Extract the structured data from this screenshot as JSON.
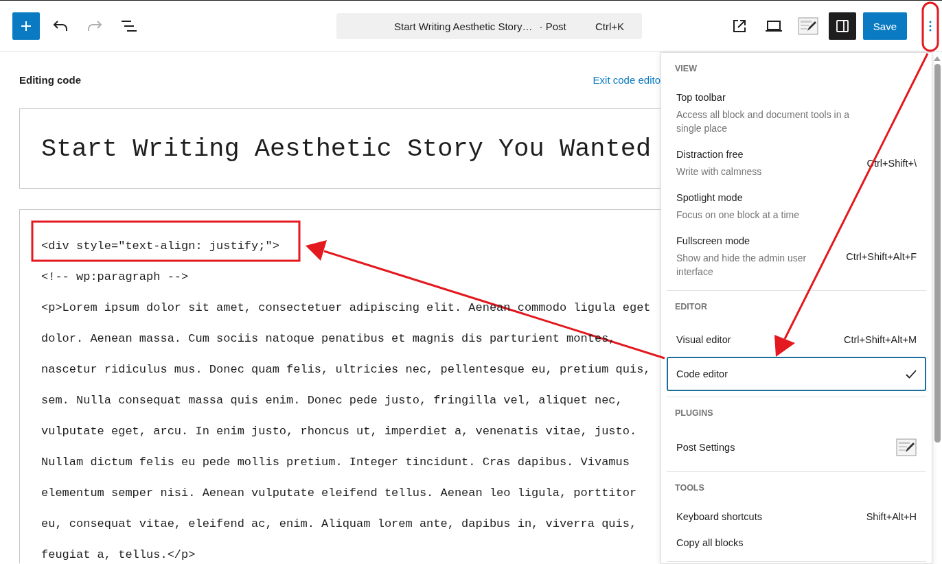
{
  "toolbar": {
    "redo": {
      "disabled": true
    },
    "command": {
      "title": "Start Writing Aesthetic Story…",
      "type": "· Post",
      "shortcut": "Ctrl+K"
    },
    "save": "Save"
  },
  "editor": {
    "heading": "Editing code",
    "exit_link": "Exit code edito",
    "title": "Start Writing Aesthetic Story You Wanted",
    "code_lines": [
      "<div style=\"text-align: justify;\">",
      "<!-- wp:paragraph -->",
      "<p>Lorem ipsum dolor sit amet, consectetuer adipiscing elit. Aenean commodo ligula eget",
      "dolor. Aenean massa. Cum sociis natoque penatibus et magnis dis parturient montes,",
      "nascetur ridiculus mus. Donec quam felis, ultricies nec, pellentesque eu, pretium quis,",
      "sem. Nulla consequat massa quis enim. Donec pede justo, fringilla vel, aliquet nec,",
      "vulputate eget, arcu. In enim justo, rhoncus ut, imperdiet a, venenatis vitae, justo.",
      "Nullam dictum felis eu pede mollis pretium. Integer tincidunt. Cras dapibus. Vivamus",
      "elementum semper nisi. Aenean vulputate eleifend tellus. Aenean leo ligula, porttitor",
      "eu, consequat vitae, eleifend ac, enim. Aliquam lorem ante, dapibus in, viverra quis,",
      "feugiat a, tellus.</p>"
    ]
  },
  "menu": {
    "sections": [
      {
        "heading": "VIEW",
        "items": [
          {
            "kind": "option",
            "label": "Top toolbar",
            "description": "Access all block and document tools in a single place"
          },
          {
            "kind": "option",
            "label": "Distraction free",
            "description": "Write with calmness",
            "shortcut": "Ctrl+Shift+\\"
          },
          {
            "kind": "option",
            "label": "Spotlight mode",
            "description": "Focus on one block at a time"
          },
          {
            "kind": "option",
            "label": "Fullscreen mode",
            "description": "Show and hide the admin user interface",
            "shortcut": "Ctrl+Shift+Alt+F"
          }
        ]
      },
      {
        "heading": "EDITOR",
        "items": [
          {
            "kind": "choice",
            "label": "Visual editor",
            "shortcut": "Ctrl+Shift+Alt+M",
            "selected": false
          },
          {
            "kind": "choice",
            "label": "Code editor",
            "selected": true
          }
        ]
      },
      {
        "heading": "PLUGINS",
        "items": [
          {
            "kind": "plugin",
            "label": "Post Settings"
          }
        ]
      },
      {
        "heading": "TOOLS",
        "items": [
          {
            "kind": "option",
            "label": "Keyboard shortcuts",
            "shortcut": "Shift+Alt+H"
          },
          {
            "kind": "option",
            "label": "Copy all blocks"
          }
        ]
      }
    ]
  }
}
